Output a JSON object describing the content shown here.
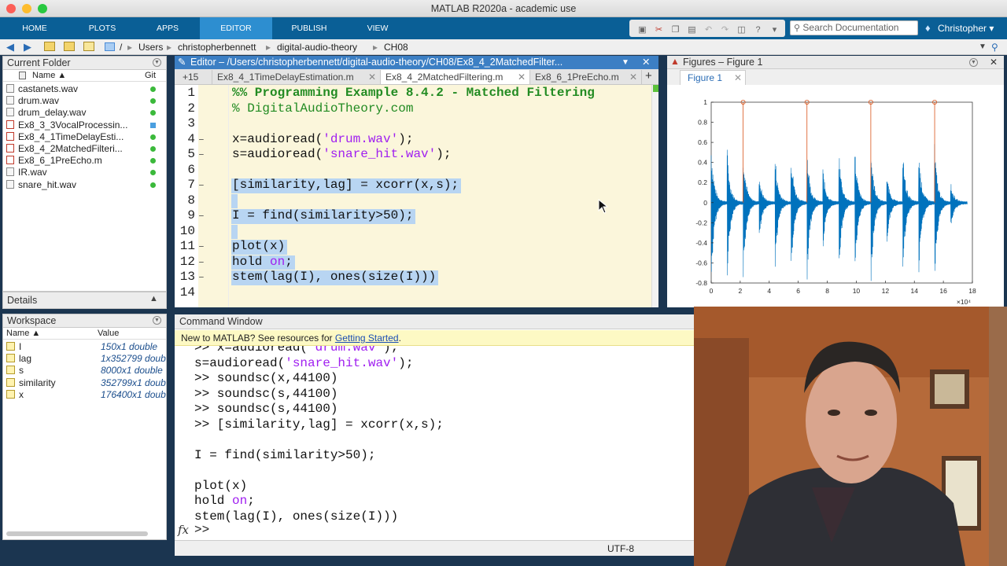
{
  "window": {
    "title": "MATLAB R2020a - academic use"
  },
  "toolstrip": {
    "tabs": [
      "HOME",
      "PLOTS",
      "APPS",
      "EDITOR",
      "PUBLISH",
      "VIEW"
    ],
    "active_tab": "EDITOR",
    "search_placeholder": "Search Documentation",
    "user": "Christopher ▾"
  },
  "address": {
    "path": [
      "/",
      "Users",
      "christopherbennett",
      "digital-audio-theory",
      "CH08"
    ]
  },
  "current_folder": {
    "title": "Current Folder",
    "col_name": "Name ▲",
    "col_git": "Git",
    "files": [
      {
        "name": "castanets.wav",
        "type": "wav",
        "git": "#3bb93b"
      },
      {
        "name": "drum.wav",
        "type": "wav",
        "git": "#3bb93b"
      },
      {
        "name": "drum_delay.wav",
        "type": "wav",
        "git": "#3bb93b"
      },
      {
        "name": "Ex8_3_3VocalProcessin...",
        "type": "m",
        "git": "#4a9fe0"
      },
      {
        "name": "Ex8_4_1TimeDelayEsti...",
        "type": "m",
        "git": "#3bb93b"
      },
      {
        "name": "Ex8_4_2MatchedFilteri...",
        "type": "m",
        "git": "#3bb93b"
      },
      {
        "name": "Ex8_6_1PreEcho.m",
        "type": "m",
        "git": "#3bb93b"
      },
      {
        "name": "IR.wav",
        "type": "wav",
        "git": "#3bb93b"
      },
      {
        "name": "snare_hit.wav",
        "type": "wav",
        "git": "#3bb93b"
      }
    ]
  },
  "details": {
    "title": "Details"
  },
  "workspace": {
    "title": "Workspace",
    "col_name": "Name ▲",
    "col_value": "Value",
    "vars": [
      {
        "name": "I",
        "value": "150x1 double"
      },
      {
        "name": "lag",
        "value": "1x352799 doub"
      },
      {
        "name": "s",
        "value": "8000x1 double"
      },
      {
        "name": "similarity",
        "value": "352799x1 doub"
      },
      {
        "name": "x",
        "value": "176400x1 doub"
      }
    ]
  },
  "editor": {
    "title": "Editor – /Users/christopherbennett/digital-audio-theory/CH08/Ex8_4_2MatchedFilter...",
    "overflow_tabs": "+15",
    "tabs": [
      "Ex8_4_1TimeDelayEstimation.m",
      "Ex8_4_2MatchedFiltering.m",
      "Ex8_6_1PreEcho.m"
    ],
    "active_tab": 1,
    "lines": [
      {
        "n": "1",
        "text": "%% Programming Example 8.4.2 - Matched Filtering"
      },
      {
        "n": "2",
        "text": "% DigitalAudioTheory.com"
      },
      {
        "n": "3",
        "text": ""
      },
      {
        "n": "4",
        "text": "x=audioread('drum.wav');"
      },
      {
        "n": "5",
        "text": "s=audioread('snare_hit.wav');"
      },
      {
        "n": "6",
        "text": ""
      },
      {
        "n": "7",
        "text": "[similarity,lag] = xcorr(x,s);"
      },
      {
        "n": "8",
        "text": ""
      },
      {
        "n": "9",
        "text": "I = find(similarity>50);"
      },
      {
        "n": "10",
        "text": ""
      },
      {
        "n": "11",
        "text": "plot(x)"
      },
      {
        "n": "12",
        "text": "hold on;"
      },
      {
        "n": "13",
        "text": "stem(lag(I), ones(size(I)))"
      },
      {
        "n": "14",
        "text": ""
      }
    ]
  },
  "figure": {
    "title": "Figures – Figure 1",
    "tab": "Figure 1"
  },
  "chart_data": {
    "type": "line",
    "xlim": [
      0,
      180000
    ],
    "ylim": [
      -0.8,
      1
    ],
    "xticks": [
      "0",
      "2",
      "4",
      "6",
      "8",
      "10",
      "12",
      "14",
      "16",
      "18"
    ],
    "yticks": [
      "1",
      "0.8",
      "0.6",
      "0.4",
      "0.2",
      "0",
      "-0.2",
      "-0.4",
      "-0.6",
      "-0.8"
    ],
    "x_exponent": "×10⁴",
    "stem_x": [
      22000,
      66000,
      110000,
      154000
    ],
    "stem_y": [
      1,
      1,
      1,
      1
    ],
    "onsets": [
      [
        0,
        0.6
      ],
      [
        11000,
        0.55
      ],
      [
        22000,
        0.58
      ],
      [
        33000,
        0.3
      ],
      [
        44000,
        0.5
      ],
      [
        55000,
        0.55
      ],
      [
        66000,
        0.58
      ],
      [
        77000,
        0.35
      ],
      [
        88000,
        0.55
      ],
      [
        99000,
        0.55
      ],
      [
        110000,
        0.6
      ],
      [
        121000,
        0.3
      ],
      [
        132000,
        0.55
      ],
      [
        143000,
        0.55
      ],
      [
        154000,
        0.58
      ],
      [
        165000,
        0.2
      ]
    ],
    "grid": false,
    "colors": {
      "signal": "#0072bd",
      "stem": "#d95319"
    }
  },
  "command_window": {
    "title": "Command Window",
    "banner_text": "New to MATLAB? See resources for ",
    "banner_link": "Getting Started",
    "banner_end": ".",
    "lines": [
      ">> x=audioread('drum.wav');",
      "s=audioread('snare_hit.wav');",
      ">> soundsc(x,44100)",
      ">> soundsc(s,44100)",
      ">> soundsc(s,44100)",
      ">> [similarity,lag] = xcorr(x,s);",
      "",
      "I = find(similarity>50);",
      "",
      "plot(x)",
      "hold on;",
      "stem(lag(I), ones(size(I)))"
    ],
    "prompt": ">>",
    "fx": "fx"
  },
  "status": {
    "encoding": "UTF-8"
  }
}
